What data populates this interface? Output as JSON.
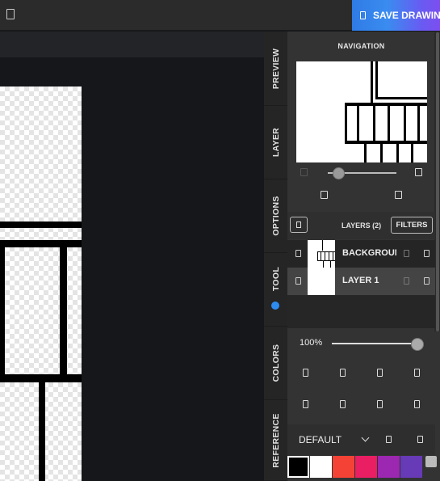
{
  "app": {
    "save_label": "SAVE DRAWING",
    "menu_icon": "document-icon",
    "save_icon": "save-icon"
  },
  "side_tabs": [
    {
      "label": "PREVIEW"
    },
    {
      "label": "LAYER"
    },
    {
      "label": "OPTIONS"
    },
    {
      "label": "TOOL"
    },
    {
      "label": "COLORS"
    },
    {
      "label": "REFERENCE"
    }
  ],
  "navigation": {
    "title": "NAVIGATION",
    "zoom_level": 0.08
  },
  "layers": {
    "title": "LAYERS (2)",
    "filters_label": "FILTERS",
    "items": [
      {
        "name": "BACKGROUND"
      },
      {
        "name": "LAYER 1"
      }
    ]
  },
  "opacity": {
    "label": "100%",
    "value": 1.0
  },
  "brush": {
    "preset_label": "DEFAULT"
  },
  "colors": {
    "accent": "#2e8cf0",
    "palette": [
      "#000000",
      "#ffffff",
      "#f44336",
      "#e91e63",
      "#9c27b0",
      "#673ab7"
    ]
  }
}
